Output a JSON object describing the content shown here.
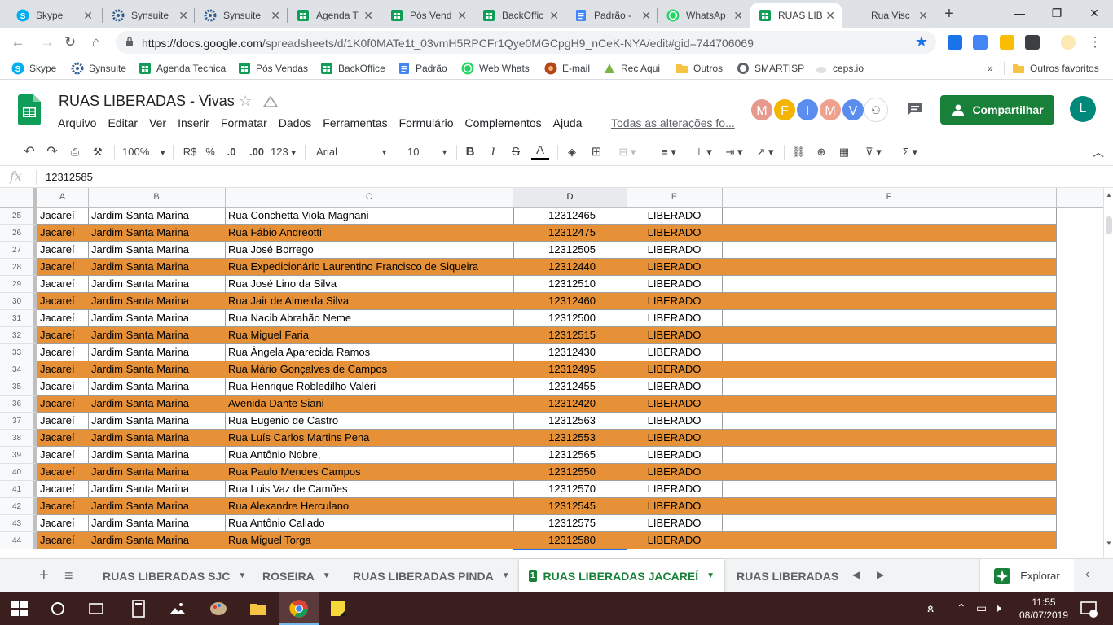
{
  "browser": {
    "tabs": [
      {
        "label": "Skype",
        "icon": "skype-icon"
      },
      {
        "label": "Synsuite",
        "icon": "gear-icon"
      },
      {
        "label": "Synsuite",
        "icon": "gear-icon"
      },
      {
        "label": "Agenda T",
        "icon": "sheets-icon"
      },
      {
        "label": "Pós Vend",
        "icon": "sheets-icon"
      },
      {
        "label": "BackOffic",
        "icon": "sheets-icon"
      },
      {
        "label": "Padrão -",
        "icon": "docs-icon"
      },
      {
        "label": "WhatsAp",
        "icon": "whatsapp-icon"
      },
      {
        "label": "RUAS LIB",
        "icon": "sheets-icon"
      },
      {
        "label": "Rua Visc",
        "icon": "map-pin-icon"
      }
    ],
    "active_tab_index": 8,
    "new_tab": "+",
    "window_controls": {
      "minimize": "—",
      "restore": "❐",
      "close": "✕"
    },
    "url_host": "https://docs.google.com",
    "url_path": "/spreadsheets/d/1K0f0MATe1t_03vmH5RPCFr1Qye0MGCpgH9_nCeK-NYA/edit#gid=744706069",
    "bookmarks": [
      "Skype",
      "Synsuite",
      "Agenda Tecnica",
      "Pós Vendas",
      "BackOffice",
      "Padrão",
      "Web Whats",
      "E-mail",
      "Rec Aqui",
      "Outros",
      "SMARTISP",
      "ceps.io"
    ],
    "bookmarks_more": "»",
    "other_bookmarks": "Outros favoritos"
  },
  "sheets": {
    "title": "RUAS LIBERADAS -  Vivas",
    "menu": [
      "Arquivo",
      "Editar",
      "Ver",
      "Inserir",
      "Formatar",
      "Dados",
      "Ferramentas",
      "Formulário",
      "Complementos",
      "Ajuda"
    ],
    "saved_status": "Todas as alterações fo...",
    "collaborators": [
      {
        "initial": "M",
        "color": "#e8998d"
      },
      {
        "initial": "F",
        "color": "#f4b400"
      },
      {
        "initial": "I",
        "color": "#5b8def"
      },
      {
        "initial": "M",
        "color": "#f0a08c"
      },
      {
        "initial": "V",
        "color": "#5b8def"
      }
    ],
    "share_label": "Compartilhar",
    "account_initial": "L",
    "toolbar": {
      "zoom": "100%",
      "currency": "R$",
      "percent": "%",
      "dec_less": ".0",
      "dec_more": ".00",
      "format_more": "123",
      "font": "Arial",
      "font_size": "10"
    },
    "formula_icon": "fx",
    "formula_value": "12312585",
    "columns": [
      "A",
      "B",
      "C",
      "D",
      "E",
      "F"
    ],
    "selected_column": "D",
    "rows": [
      {
        "n": "25",
        "city": "Jacareí",
        "district": "Jardim Santa Marina",
        "street": "Rua Conchetta Viola Magnani",
        "code": "12312465",
        "status": "LIBERADO"
      },
      {
        "n": "26",
        "city": "Jacareí",
        "district": "Jardim Santa Marina",
        "street": "Rua Fábio Andreotti",
        "code": "12312475",
        "status": "LIBERADO"
      },
      {
        "n": "27",
        "city": "Jacareí",
        "district": "Jardim Santa Marina",
        "street": "Rua José Borrego",
        "code": "12312505",
        "status": "LIBERADO"
      },
      {
        "n": "28",
        "city": "Jacareí",
        "district": "Jardim Santa Marina",
        "street": "Rua Expedicionário Laurentino Francisco de Siqueira",
        "code": "12312440",
        "status": "LIBERADO"
      },
      {
        "n": "29",
        "city": "Jacareí",
        "district": "Jardim Santa Marina",
        "street": "Rua José Lino da Silva",
        "code": "12312510",
        "status": "LIBERADO"
      },
      {
        "n": "30",
        "city": "Jacareí",
        "district": "Jardim Santa Marina",
        "street": "Rua Jair de Almeida Silva",
        "code": "12312460",
        "status": "LIBERADO"
      },
      {
        "n": "31",
        "city": "Jacareí",
        "district": "Jardim Santa Marina",
        "street": "Rua Nacib Abrahão Neme",
        "code": "12312500",
        "status": "LIBERADO"
      },
      {
        "n": "32",
        "city": "Jacareí",
        "district": "Jardim Santa Marina",
        "street": "Rua Miguel Faria",
        "code": "12312515",
        "status": "LIBERADO"
      },
      {
        "n": "33",
        "city": "Jacareí",
        "district": "Jardim Santa Marina",
        "street": "Rua Ângela Aparecida Ramos",
        "code": "12312430",
        "status": "LIBERADO"
      },
      {
        "n": "34",
        "city": "Jacareí",
        "district": "Jardim Santa Marina",
        "street": "Rua Mário Gonçalves de Campos",
        "code": "12312495",
        "status": "LIBERADO"
      },
      {
        "n": "35",
        "city": "Jacareí",
        "district": "Jardim Santa Marina",
        "street": "Rua Henrique Robledilho Valéri",
        "code": "12312455",
        "status": "LIBERADO"
      },
      {
        "n": "36",
        "city": "Jacareí",
        "district": "Jardim Santa Marina",
        "street": "Avenida Dante Siani",
        "code": "12312420",
        "status": "LIBERADO"
      },
      {
        "n": "37",
        "city": "Jacareí",
        "district": "Jardim Santa Marina",
        "street": "Rua Eugenio de Castro",
        "code": "12312563",
        "status": "LIBERADO"
      },
      {
        "n": "38",
        "city": "Jacareí",
        "district": "Jardim Santa Marina",
        "street": "Rua Luís Carlos Martins Pena",
        "code": "12312553",
        "status": "LIBERADO"
      },
      {
        "n": "39",
        "city": "Jacareí",
        "district": "Jardim Santa Marina",
        "street": "Rua Antônio Nobre,",
        "code": "12312565",
        "status": "LIBERADO"
      },
      {
        "n": "40",
        "city": "Jacareí",
        "district": "Jardim Santa Marina",
        "street": "Rua Paulo Mendes Campos",
        "code": "12312550",
        "status": "LIBERADO"
      },
      {
        "n": "41",
        "city": "Jacareí",
        "district": "Jardim Santa Marina",
        "street": "Rua Luis Vaz de Camões",
        "code": "12312570",
        "status": "LIBERADO"
      },
      {
        "n": "42",
        "city": "Jacareí",
        "district": "Jardim Santa Marina",
        "street": "Rua Alexandre Herculano",
        "code": "12312545",
        "status": "LIBERADO"
      },
      {
        "n": "43",
        "city": "Jacareí",
        "district": "Jardim Santa Marina",
        "street": "Rua Antônio Callado",
        "code": "12312575",
        "status": "LIBERADO"
      },
      {
        "n": "44",
        "city": "Jacareí",
        "district": "Jardim Santa Marina",
        "street": "Rua Miguel Torga",
        "code": "12312580",
        "status": "LIBERADO"
      }
    ],
    "alt_row_color": "#e69138",
    "sheet_tabs": [
      "RUAS LIBERADAS SJC",
      "ROSEIRA",
      "RUAS LIBERADAS PINDA",
      "RUAS LIBERADAS JACAREÍ",
      "RUAS LIBERADAS I"
    ],
    "active_sheet_index": 3,
    "explore_label": "Explorar"
  },
  "taskbar": {
    "time": "11:55",
    "date": "08/07/2019"
  }
}
